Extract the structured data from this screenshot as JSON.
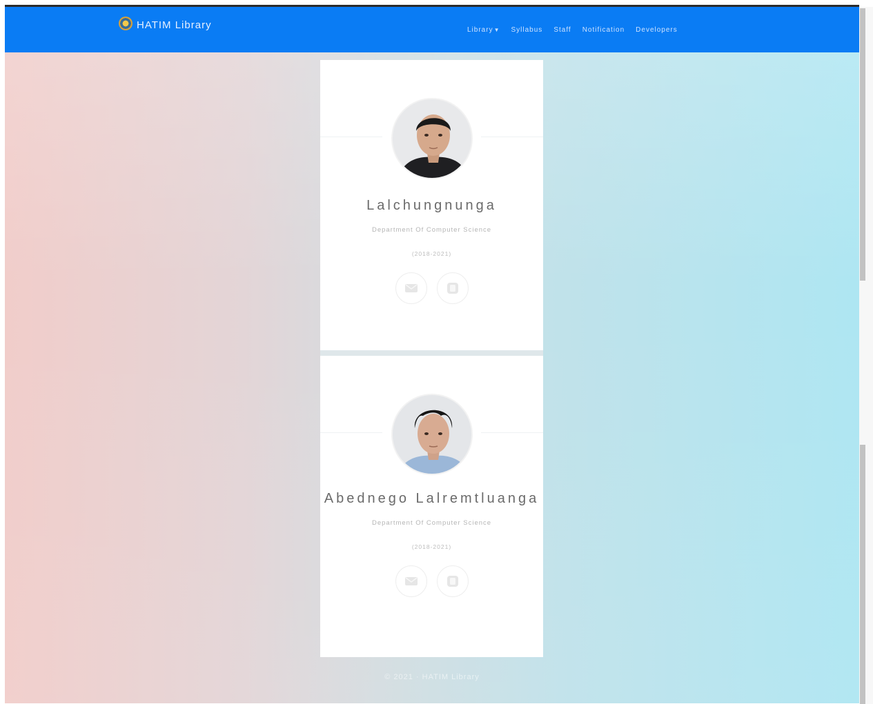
{
  "navbar": {
    "brand": "HATIM Library",
    "links": [
      {
        "label": "Library",
        "has_dropdown": true
      },
      {
        "label": "Syllabus"
      },
      {
        "label": "Staff"
      },
      {
        "label": "Notification"
      },
      {
        "label": "Developers"
      }
    ],
    "background": "#0a7cf4"
  },
  "developers": [
    {
      "name": "Lalchungnunga",
      "department": "Department Of Computer Science",
      "years": "(2018-2021)",
      "social_icons": [
        "mail-icon",
        "phone-icon"
      ]
    },
    {
      "name": "Abednego Lalremtluanga",
      "department": "Department Of Computer Science",
      "years": "(2018-2021)",
      "social_icons": [
        "mail-icon",
        "phone-icon"
      ]
    }
  ],
  "footer": {
    "text": "© 2021 · HATIM Library"
  },
  "colors": {
    "gradient_left": "#f1cdca",
    "gradient_right": "#aee6f2",
    "card": "#ffffff"
  }
}
